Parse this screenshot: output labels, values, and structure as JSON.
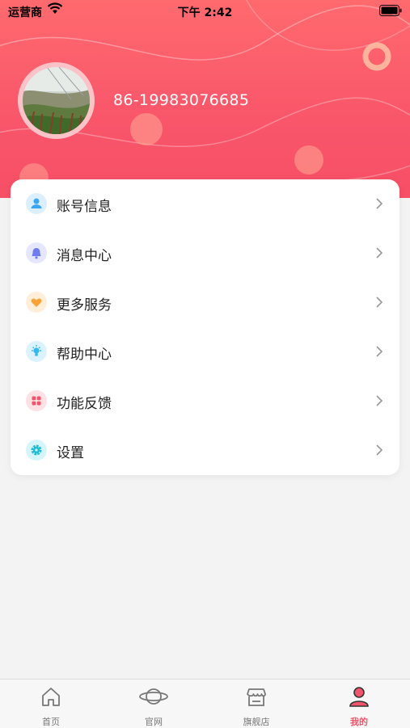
{
  "status_bar": {
    "carrier": "运营商",
    "time": "下午 2:42"
  },
  "profile": {
    "phone": "86-19983076685"
  },
  "colors": {
    "accent": "#f74f66",
    "card": "#ffffff",
    "tab_active": "#f0566b"
  },
  "menu": [
    {
      "label": "账号信息",
      "icon": "user-icon"
    },
    {
      "label": "消息中心",
      "icon": "bell-icon"
    },
    {
      "label": "更多服务",
      "icon": "heart-icon"
    },
    {
      "label": "帮助中心",
      "icon": "lightbulb-icon"
    },
    {
      "label": "功能反馈",
      "icon": "grid-icon"
    },
    {
      "label": "设置",
      "icon": "gear-icon"
    }
  ],
  "tabs": [
    {
      "label": "首页",
      "icon": "home-icon",
      "active": false
    },
    {
      "label": "官网",
      "icon": "planet-icon",
      "active": false
    },
    {
      "label": "旗舰店",
      "icon": "store-icon",
      "active": false
    },
    {
      "label": "我的",
      "icon": "profile-icon",
      "active": true
    }
  ]
}
